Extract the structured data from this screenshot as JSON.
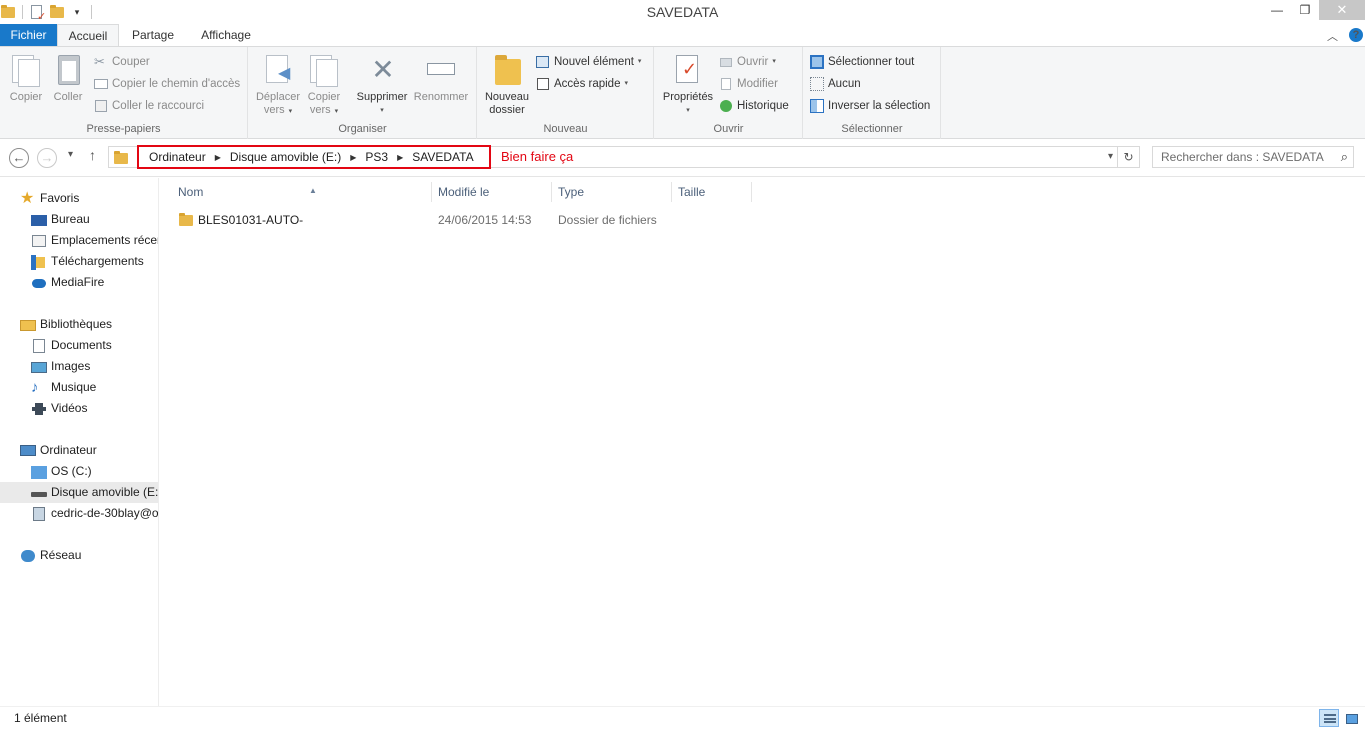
{
  "window": {
    "title": "SAVEDATA"
  },
  "ribbon_tabs": {
    "file": "Fichier",
    "home": "Accueil",
    "share": "Partage",
    "view": "Affichage"
  },
  "ribbon": {
    "clipboard": {
      "label": "Presse-papiers",
      "copy": "Copier",
      "paste": "Coller",
      "cut": "Couper",
      "copy_path": "Copier le chemin d'accès",
      "paste_shortcut": "Coller le raccourci"
    },
    "organize": {
      "label": "Organiser",
      "move_to_1": "Déplacer",
      "move_to_2": "vers",
      "copy_to_1": "Copier",
      "copy_to_2": "vers",
      "delete": "Supprimer",
      "rename": "Renommer"
    },
    "new": {
      "label": "Nouveau",
      "new_folder_1": "Nouveau",
      "new_folder_2": "dossier",
      "new_item": "Nouvel élément",
      "easy_access": "Accès rapide"
    },
    "open": {
      "label": "Ouvrir",
      "properties": "Propriétés",
      "open": "Ouvrir",
      "edit": "Modifier",
      "history": "Historique"
    },
    "select": {
      "label": "Sélectionner",
      "select_all": "Sélectionner tout",
      "select_none": "Aucun",
      "invert": "Inverser la sélection"
    }
  },
  "address": {
    "crumbs": [
      "Ordinateur",
      "Disque amovible (E:)",
      "PS3",
      "SAVEDATA"
    ],
    "annotation": "Bien faire ça"
  },
  "search": {
    "placeholder": "Rechercher dans : SAVEDATA"
  },
  "nav": {
    "favorites": "Favoris",
    "desktop": "Bureau",
    "recent": "Emplacements récents",
    "downloads": "Téléchargements",
    "mediafire": "MediaFire",
    "libraries": "Bibliothèques",
    "documents": "Documents",
    "images": "Images",
    "music": "Musique",
    "videos": "Vidéos",
    "computer": "Ordinateur",
    "os_c": "OS (C:)",
    "removable": "Disque amovible (E:)",
    "network_drive": "cedric-de-30blay@o",
    "network": "Réseau"
  },
  "columns": {
    "name": "Nom",
    "modified": "Modifié le",
    "type": "Type",
    "size": "Taille"
  },
  "files": [
    {
      "name": "BLES01031-AUTO-",
      "modified": "24/06/2015 14:53",
      "type": "Dossier de fichiers",
      "size": ""
    }
  ],
  "status": {
    "count": "1 élément"
  },
  "icons": {
    "folder": "folder-icon",
    "favorites": "star-icon",
    "computer": "computer-icon",
    "network": "network-icon"
  },
  "colors": {
    "accent": "#1979ca",
    "annotation": "#e30613",
    "folder": "#efc14f"
  }
}
